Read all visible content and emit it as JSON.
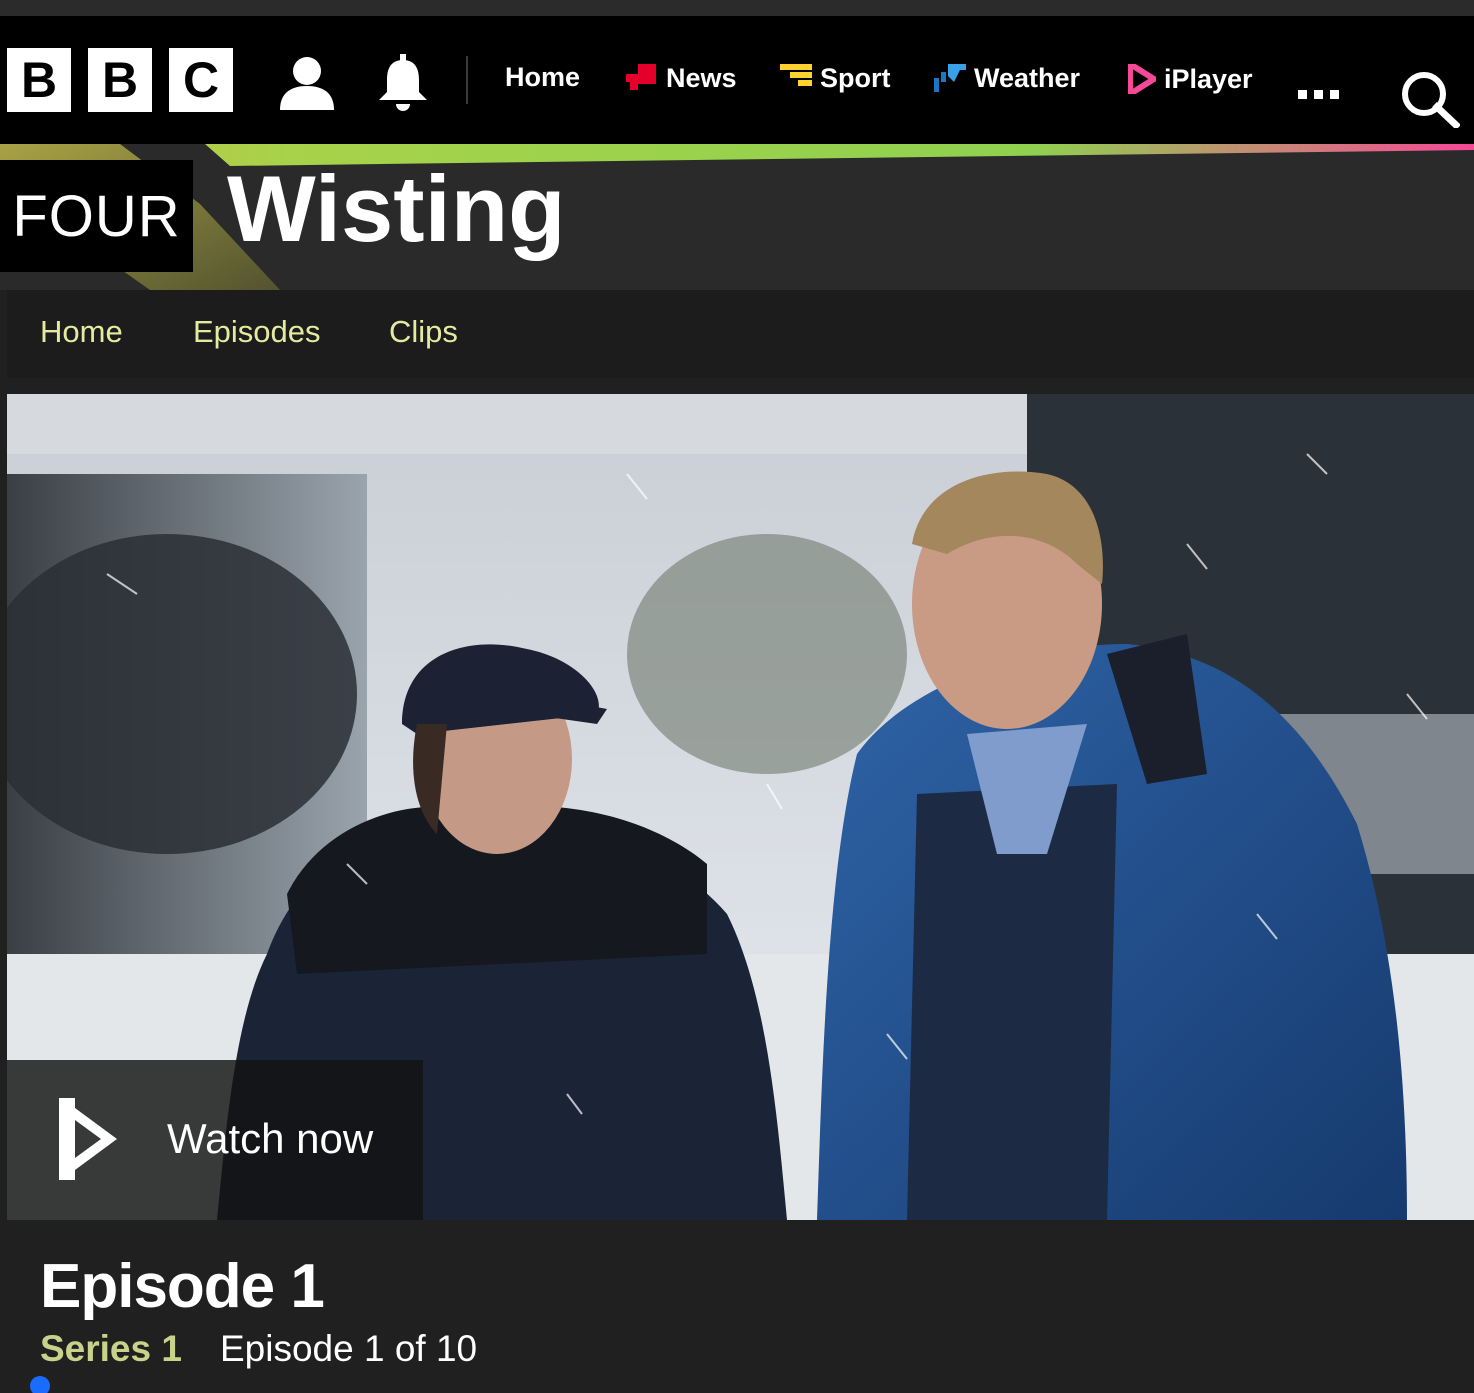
{
  "masthead": {
    "logo": {
      "letters": [
        "B",
        "B",
        "C"
      ]
    },
    "icons": {
      "account": "account-icon",
      "notifications": "bell-icon",
      "more": "more-icon",
      "search": "search-icon"
    },
    "nav": [
      {
        "label": "Home",
        "icon": null
      },
      {
        "label": "News",
        "icon": "news-icon",
        "color": "#e4002b"
      },
      {
        "label": "Sport",
        "icon": "sport-icon",
        "color": "#ffd230"
      },
      {
        "label": "Weather",
        "icon": "weather-icon",
        "color": "#1a78c2"
      },
      {
        "label": "iPlayer",
        "icon": "iplayer-icon",
        "color": "#f54997"
      }
    ]
  },
  "brand": {
    "channel": "FOUR",
    "title": "Wisting",
    "gradient_colors": [
      "#c8c24a",
      "#8fd14f",
      "#f54997"
    ]
  },
  "subnav": [
    "Home",
    "Episodes",
    "Clips"
  ],
  "hero": {
    "image": "two-detectives-in-snow",
    "watch_label": "Watch now"
  },
  "episode": {
    "title": "Episode 1",
    "series": "Series 1",
    "position": "Episode 1 of 10"
  }
}
